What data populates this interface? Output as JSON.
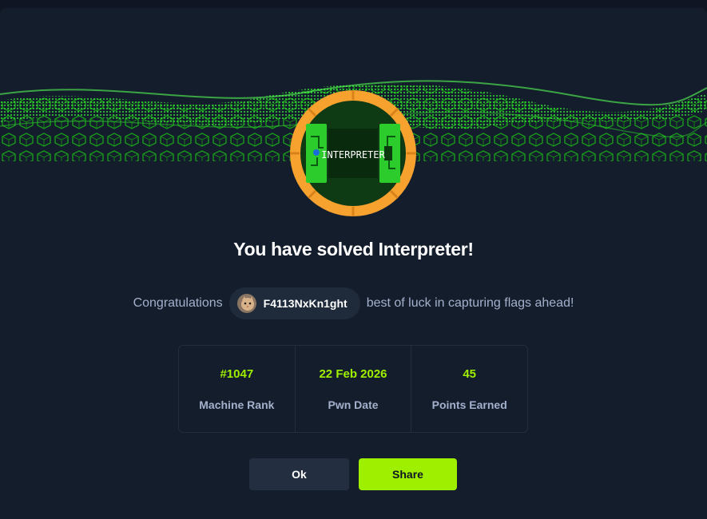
{
  "modal": {
    "title": "You have solved Interpreter!",
    "badge_text": "INTERPRETER",
    "congrats_prefix": "Congratulations",
    "username": "F4113NxKn1ght",
    "congrats_suffix": "best of luck in capturing flags ahead!"
  },
  "stats": [
    {
      "value": "#1047",
      "label": "Machine Rank"
    },
    {
      "value": "22 Feb 2026",
      "label": "Pwn Date"
    },
    {
      "value": "45",
      "label": "Points Earned"
    }
  ],
  "buttons": {
    "ok_label": "Ok",
    "share_label": "Share"
  },
  "colors": {
    "accent": "#9fef00",
    "background": "#141d2b",
    "badge_ring": "#f7a12f"
  }
}
